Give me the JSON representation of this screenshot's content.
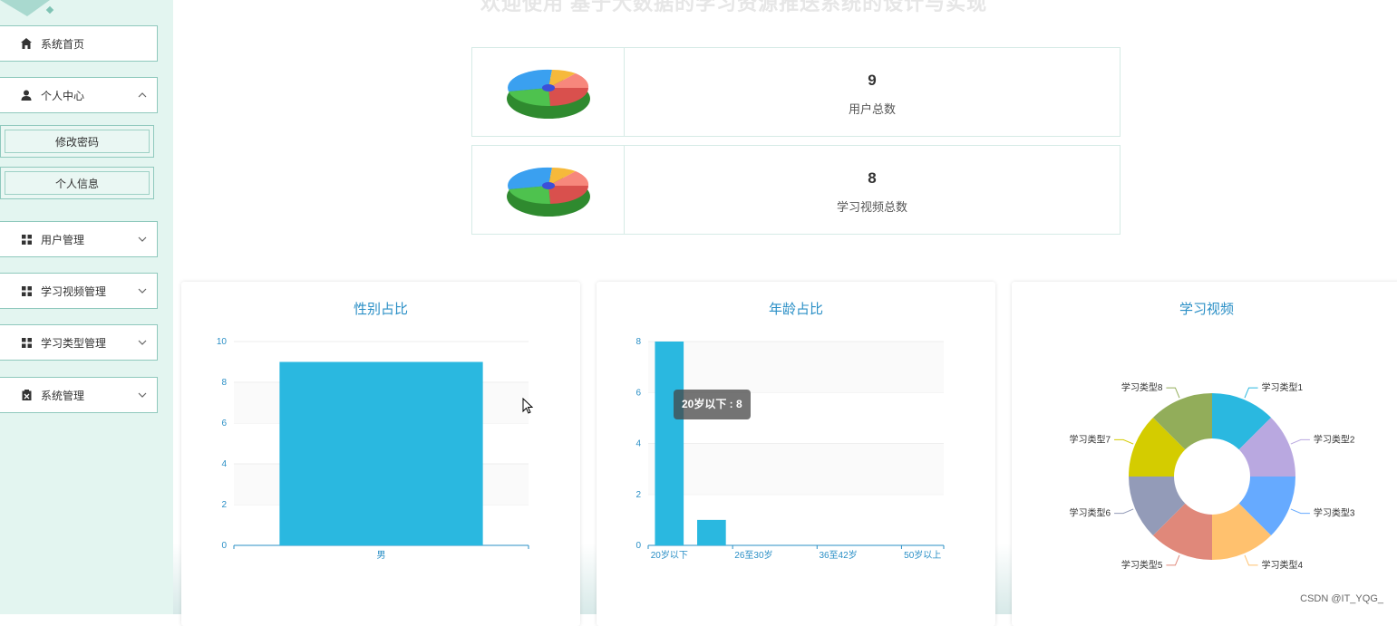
{
  "header": {
    "title": "欢迎使用 基于大数据的学习资源推送系统的设计与实现"
  },
  "sidebar": {
    "items": [
      {
        "label": "系统首页",
        "icon": "home-icon"
      },
      {
        "label": "个人中心",
        "icon": "user-icon",
        "expanded": true,
        "children": [
          {
            "label": "修改密码"
          },
          {
            "label": "个人信息"
          }
        ]
      },
      {
        "label": "用户管理",
        "icon": "grid-icon"
      },
      {
        "label": "学习视频管理",
        "icon": "grid-icon"
      },
      {
        "label": "学习类型管理",
        "icon": "grid-icon"
      },
      {
        "label": "系统管理",
        "icon": "clipboard-icon"
      }
    ]
  },
  "stats": [
    {
      "value": "9",
      "label": "用户总数",
      "icon": "pie-3d-icon"
    },
    {
      "value": "8",
      "label": "学习视频总数",
      "icon": "pie-3d-icon"
    }
  ],
  "charts": {
    "gender": {
      "title": "性别占比"
    },
    "age": {
      "title": "年龄占比",
      "tooltip": "20岁以下 : 8"
    },
    "videos": {
      "title": "学习视频"
    }
  },
  "chart_data": [
    {
      "type": "bar",
      "title": "性别占比",
      "categories": [
        "男"
      ],
      "values": [
        9
      ],
      "ylim": [
        0,
        10
      ],
      "yticks": [
        0,
        2,
        4,
        6,
        8,
        10
      ],
      "grid": true
    },
    {
      "type": "bar",
      "title": "年龄占比",
      "categories": [
        "20岁以下",
        "",
        "26至30岁",
        "",
        "36至42岁",
        "",
        "50岁以上"
      ],
      "values": [
        8,
        1,
        0,
        0,
        0,
        0,
        0
      ],
      "ylim": [
        0,
        8
      ],
      "yticks": [
        0,
        2,
        4,
        6,
        8
      ],
      "grid": true
    },
    {
      "type": "pie",
      "title": "学习视频",
      "donut": true,
      "labels": [
        "学习类型1",
        "学习类型2",
        "学习类型3",
        "学习类型4",
        "学习类型5",
        "学习类型6",
        "学习类型7",
        "学习类型8"
      ],
      "values": [
        1,
        1,
        1,
        1,
        1,
        1,
        1,
        1
      ],
      "colors": [
        "#2ab8e0",
        "#b9a8e0",
        "#66aaff",
        "#ffc16e",
        "#e0887a",
        "#939bb8",
        "#d4cc00",
        "#92ad5a"
      ]
    }
  ],
  "colors": {
    "accent": "#2a8fc6",
    "bar": "#2ab8e0",
    "sidebar_bg": "#e3f5f0"
  },
  "watermark": "CSDN @IT_YQG_"
}
